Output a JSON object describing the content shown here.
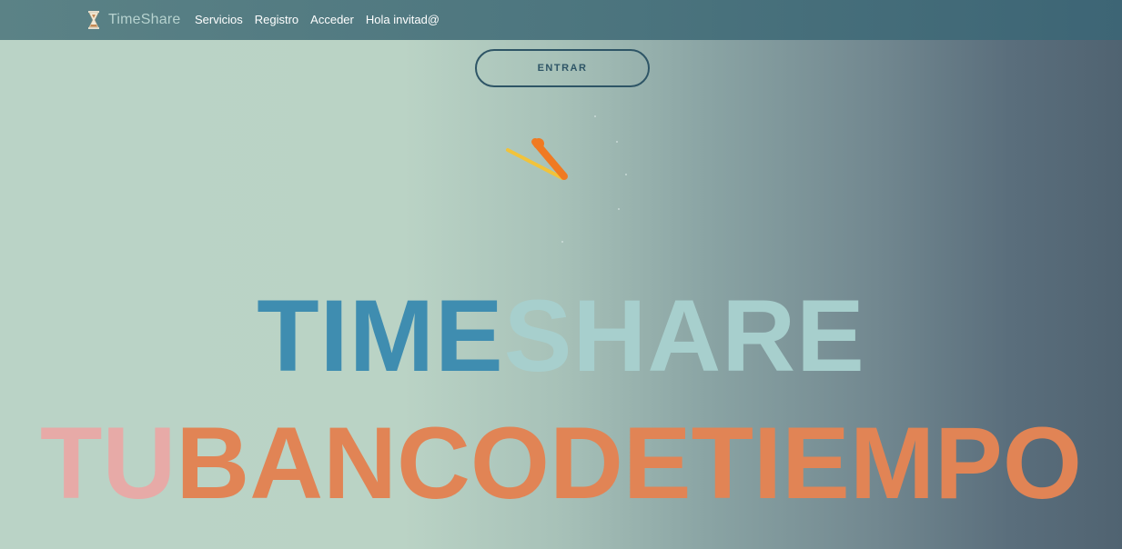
{
  "navbar": {
    "brand": "TimeShare",
    "links": [
      "Servicios",
      "Registro",
      "Acceder"
    ],
    "greeting": "Hola invitad@"
  },
  "hero": {
    "enter_button": "ENTRAR",
    "title_part1": "TIME",
    "title_part2": "SHARE",
    "subtitle_part1": "TU",
    "subtitle_part2": "BANCODETIEMPO"
  },
  "colors": {
    "title_blue": "#3f8db0",
    "title_light": "#a7cfcd",
    "subtitle_pink": "#e7aaa7",
    "subtitle_orange": "#e18455",
    "navbar": "#4d767f"
  },
  "icons": {
    "brand": "hourglass-icon",
    "decoration": "shooting-star-icon"
  }
}
